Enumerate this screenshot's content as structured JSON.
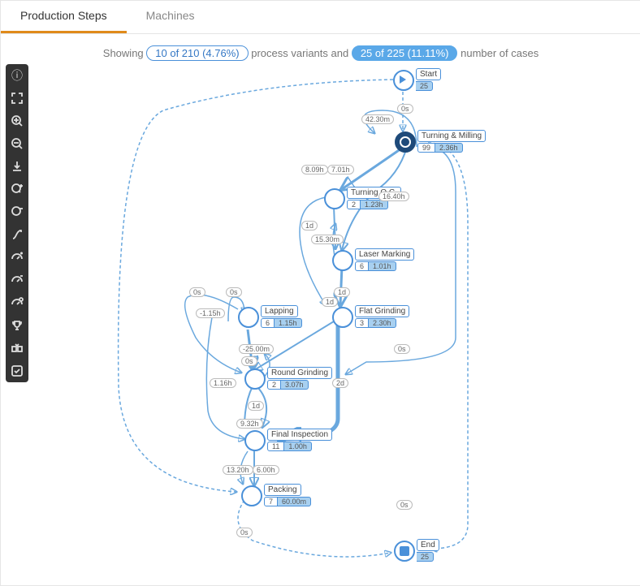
{
  "tabs": [
    "Production Steps",
    "Machines"
  ],
  "summary": {
    "prefix": "Showing ",
    "variants": "10 of 210 (4.76%)",
    "mid": " process variants and ",
    "cases": "25 of 225 (11.11%)",
    "suffix": " number of cases"
  },
  "nodes": {
    "start": {
      "label": "Start",
      "count": "25"
    },
    "turning_milling": {
      "label": "Turning & Milling",
      "count": "99",
      "dur": "2.36h"
    },
    "turning_qc": {
      "label": "Turning Q.C.",
      "count": "2",
      "dur": "1.23h"
    },
    "laser_marking": {
      "label": "Laser Marking",
      "count": "6",
      "dur": "1.01h"
    },
    "flat_grinding": {
      "label": "Flat Grinding",
      "count": "3",
      "dur": "2.30h"
    },
    "lapping": {
      "label": "Lapping",
      "count": "6",
      "dur": "1.15h"
    },
    "round_grinding": {
      "label": "Round Grinding",
      "count": "2",
      "dur": "3.07h"
    },
    "final_inspection": {
      "label": "Final Inspection",
      "count": "11",
      "dur": "1.00h"
    },
    "packing": {
      "label": "Packing",
      "count": "7",
      "dur": "60.00m"
    },
    "end": {
      "label": "End",
      "count": "25"
    }
  },
  "edges": [
    "0s",
    "42.30m",
    "8.09h",
    "7.01h",
    "16.40h",
    "1d",
    "15.30m",
    "1d",
    "1d",
    "0s",
    "0s",
    "-1.15h",
    "-25.00m",
    "0s",
    "1.16h",
    "2d",
    "1d",
    "9.32h",
    "13.20h",
    "6.00h",
    "0s",
    "0s",
    "0s"
  ],
  "toolbar_icons": [
    "info",
    "fit-screen",
    "zoom-in",
    "zoom-out",
    "export-svg",
    "add-activities",
    "remove-activities",
    "path",
    "performance-plus",
    "performance-minus",
    "performance-settings",
    "benchmark",
    "compare",
    "conformance-check"
  ]
}
